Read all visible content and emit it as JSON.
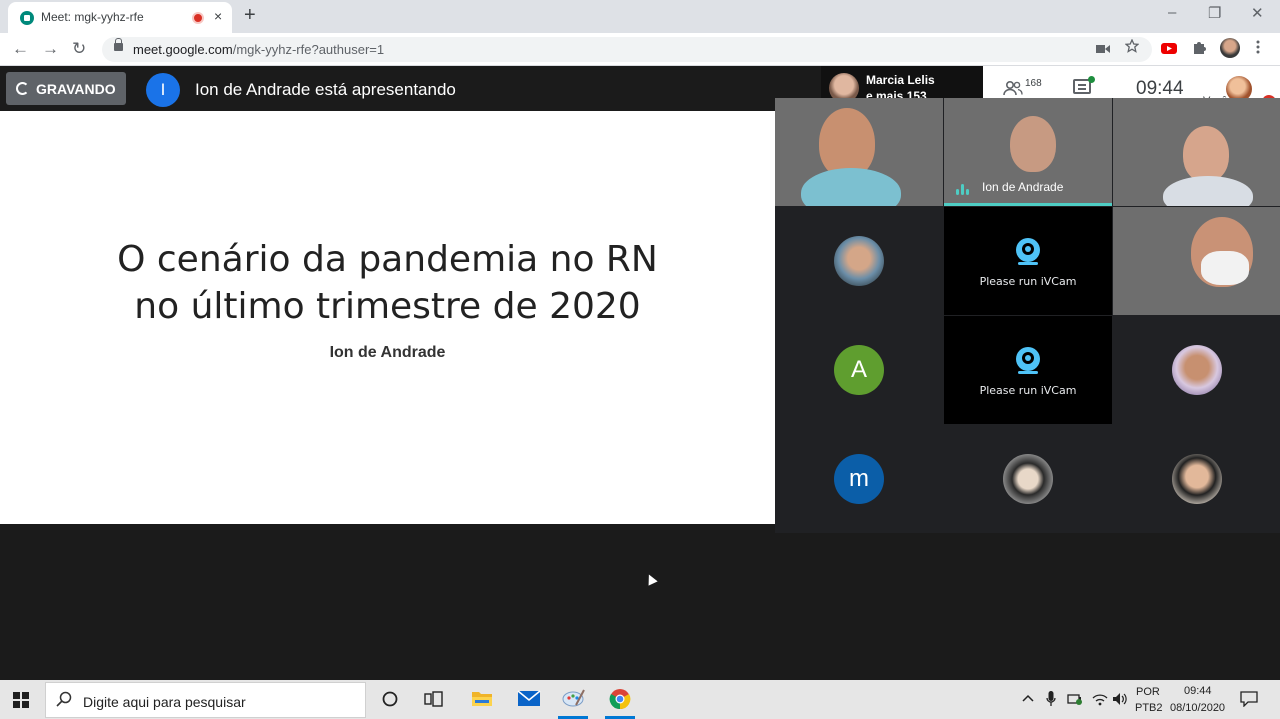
{
  "browser": {
    "tab_title": "Meet: mgk-yyhz-rfe",
    "tab_close": "×",
    "new_tab": "+",
    "url_domain": "meet.google.com",
    "url_path": "/mgk-yyhz-rfe?authuser=1",
    "window_controls": {
      "minimize": "–",
      "maximize": "❐",
      "close": "✕"
    },
    "nav": {
      "back": "←",
      "forward": "→",
      "reload": "↻"
    }
  },
  "meet": {
    "recording_label": "GRAVANDO",
    "presenter_initial": "I",
    "presenter_text": "Ion de Andrade está apresentando",
    "speaker_line1": "Marcia Lelis",
    "speaker_line2": "e mais 153",
    "participants_count": "168",
    "clock": "09:44",
    "you_label": "Você"
  },
  "slide": {
    "title_line1": "O cenário da pandemia no RN",
    "title_line2": "no último trimestre de 2020",
    "author": "Ion de Andrade"
  },
  "tiles": {
    "active_speaker_name": "Ion de Andrade",
    "ivcam_text_1": "Please run iVCam",
    "ivcam_text_2": "Please run iVCam",
    "avatar_a": "A",
    "avatar_m": "m"
  },
  "colors": {
    "avatar_a": "#5f9e2f",
    "avatar_m": "#0b5ea8",
    "accent_teal": "#4ecdc4",
    "record_red": "#d93025"
  },
  "taskbar": {
    "search_placeholder": "Digite aqui para pesquisar",
    "lang_top": "POR",
    "lang_bottom": "PTB2",
    "time": "09:44",
    "date": "08/10/2020"
  }
}
